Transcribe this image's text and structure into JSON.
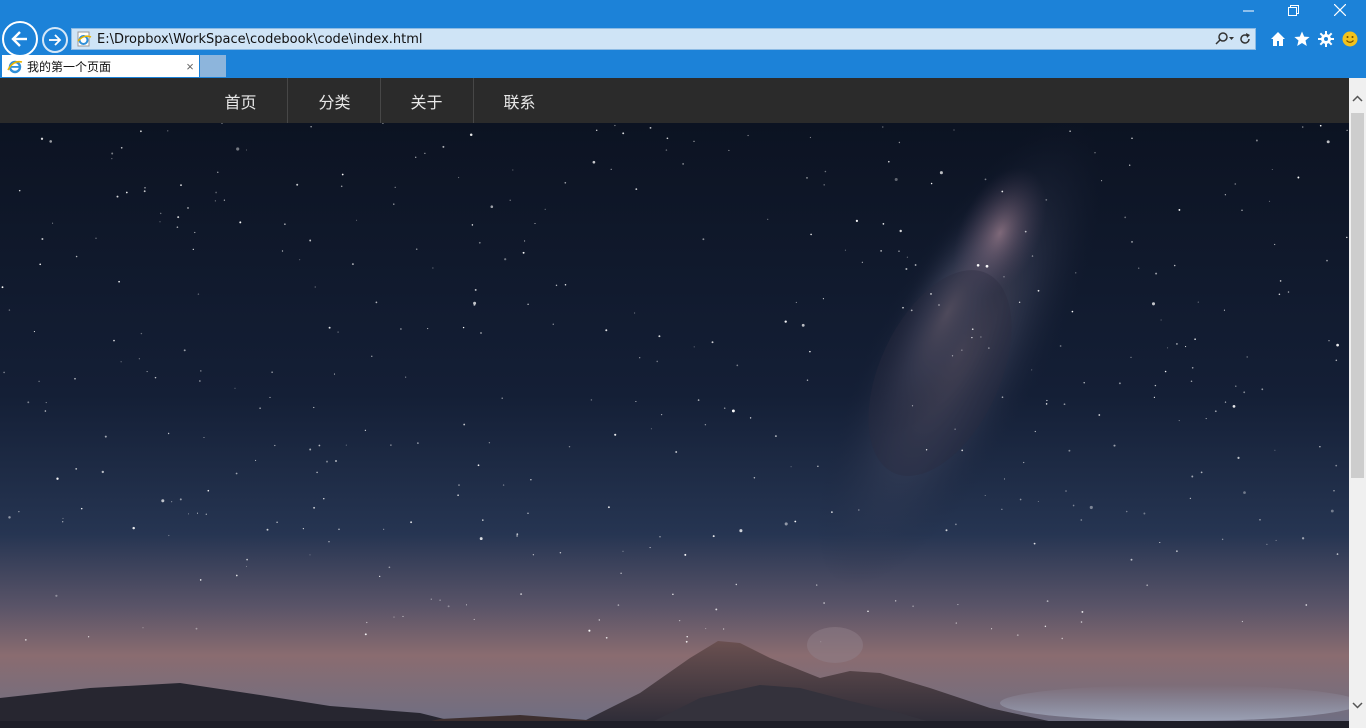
{
  "browser": {
    "address": "E:\\Dropbox\\WorkSpace\\codebook\\code\\index.html",
    "tab_title": "我的第一个页面",
    "tab_close": "×",
    "accent": "#1c82d8"
  },
  "site_nav": {
    "background": "#2b2b2b",
    "items": [
      {
        "label": "首页"
      },
      {
        "label": "分类"
      },
      {
        "label": "关于"
      },
      {
        "label": "联系"
      }
    ]
  },
  "hero": {
    "subject": "starry night sky with milky way over volcanic mountains"
  }
}
